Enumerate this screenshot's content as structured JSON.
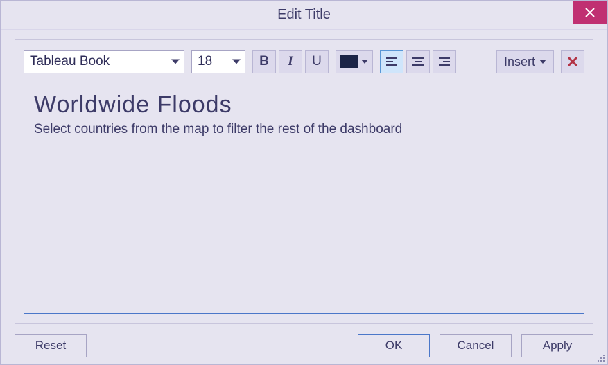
{
  "window": {
    "title": "Edit Title"
  },
  "toolbar": {
    "font": "Tableau Book",
    "size": "18",
    "bold_label": "B",
    "italic_label": "I",
    "underline_label": "U",
    "color_value": "#1b2346",
    "insert_label": "Insert"
  },
  "content": {
    "heading": "Worldwide Floods",
    "subheading": "Select countries from the map to filter the rest of the dashboard"
  },
  "buttons": {
    "reset": "Reset",
    "ok": "OK",
    "cancel": "Cancel",
    "apply": "Apply"
  },
  "colors": {
    "accent": "#4b77c9",
    "close_bg": "#c03072",
    "clear_x": "#b33446"
  }
}
